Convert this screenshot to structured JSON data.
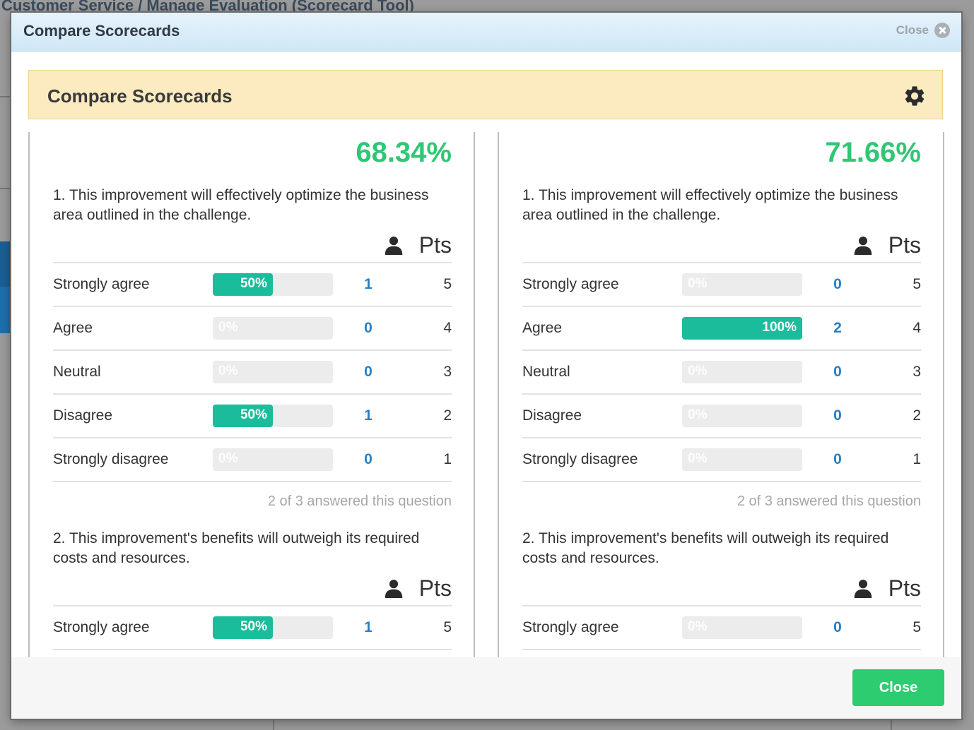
{
  "background": {
    "page_title": "Customer Service / Manage Evaluation (Scorecard Tool)"
  },
  "modal": {
    "title": "Compare Scorecards",
    "close_label": "Close",
    "panel_title": "Compare Scorecards",
    "footer_close_label": "Close"
  },
  "columns": [
    {
      "score": "68.34%",
      "questions": [
        {
          "text": "1. This improvement will effectively optimize the business area outlined in the challenge.",
          "pts_header": "Pts",
          "answers": [
            {
              "label": "Strongly agree",
              "percent_text": "50%",
              "percent": 50,
              "count": "1",
              "pts": "5"
            },
            {
              "label": "Agree",
              "percent_text": "0%",
              "percent": 0,
              "count": "0",
              "pts": "4"
            },
            {
              "label": "Neutral",
              "percent_text": "0%",
              "percent": 0,
              "count": "0",
              "pts": "3"
            },
            {
              "label": "Disagree",
              "percent_text": "50%",
              "percent": 50,
              "count": "1",
              "pts": "2"
            },
            {
              "label": "Strongly disagree",
              "percent_text": "0%",
              "percent": 0,
              "count": "0",
              "pts": "1"
            }
          ],
          "answered": "2 of 3 answered this question"
        },
        {
          "text": "2. This improvement's benefits will outweigh its required costs and resources.",
          "pts_header": "Pts",
          "answers": [
            {
              "label": "Strongly agree",
              "percent_text": "50%",
              "percent": 50,
              "count": "1",
              "pts": "5"
            }
          ]
        }
      ]
    },
    {
      "score": "71.66%",
      "questions": [
        {
          "text": "1. This improvement will effectively optimize the business area outlined in the challenge.",
          "pts_header": "Pts",
          "answers": [
            {
              "label": "Strongly agree",
              "percent_text": "0%",
              "percent": 0,
              "count": "0",
              "pts": "5"
            },
            {
              "label": "Agree",
              "percent_text": "100%",
              "percent": 100,
              "count": "2",
              "pts": "4"
            },
            {
              "label": "Neutral",
              "percent_text": "0%",
              "percent": 0,
              "count": "0",
              "pts": "3"
            },
            {
              "label": "Disagree",
              "percent_text": "0%",
              "percent": 0,
              "count": "0",
              "pts": "2"
            },
            {
              "label": "Strongly disagree",
              "percent_text": "0%",
              "percent": 0,
              "count": "0",
              "pts": "1"
            }
          ],
          "answered": "2 of 3 answered this question"
        },
        {
          "text": "2. This improvement's benefits will outweigh its required costs and resources.",
          "pts_header": "Pts",
          "answers": [
            {
              "label": "Strongly agree",
              "percent_text": "0%",
              "percent": 0,
              "count": "0",
              "pts": "5"
            }
          ]
        }
      ]
    }
  ],
  "colors": {
    "score_green": "#2fc774",
    "bar_fill": "#1bbc9b",
    "count_blue": "#2a7fc3",
    "close_button": "#2ecc71",
    "banner_bg": "#fcebc0"
  },
  "icons": {
    "header_close": "close-circle-icon",
    "panel_settings": "gear-icon",
    "respondents": "user-icon"
  }
}
